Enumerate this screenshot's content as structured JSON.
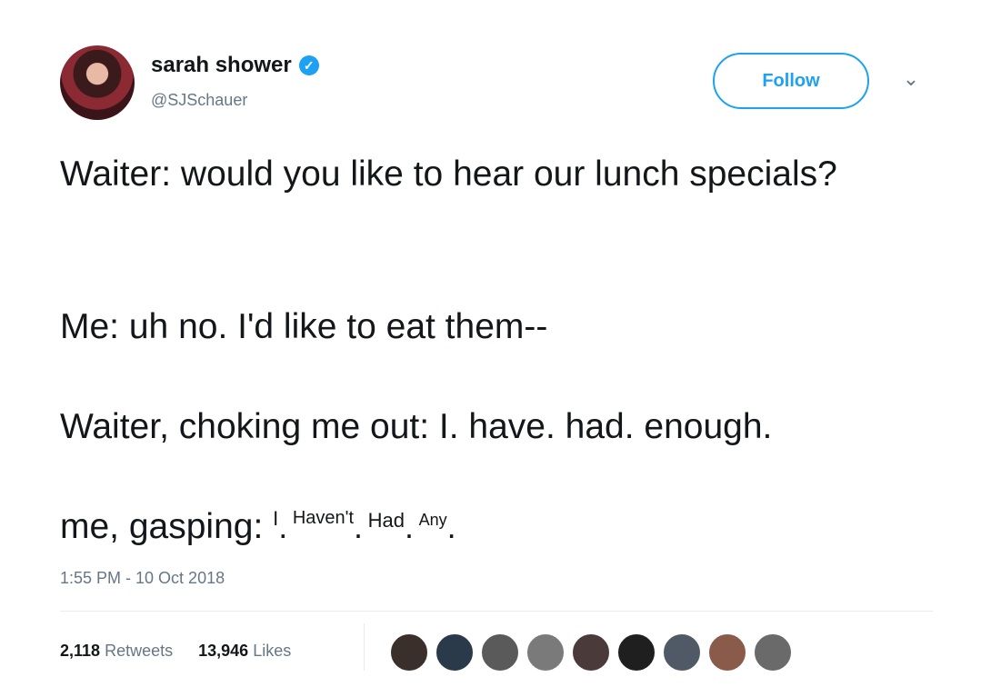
{
  "tweet": {
    "display_name": "sarah shower",
    "handle": "@SJSchauer",
    "follow_label": "Follow",
    "lines": [
      "Waiter: would you like to hear our lunch specials?",
      "Me: uh no. I'd like to eat them--",
      "Waiter, choking me out: I. have. had. enough.",
      "me, gasping:"
    ],
    "gasp_words": [
      "I",
      "Haven't",
      "Had",
      "Any"
    ],
    "timestamp": "1:55 PM - 10 Oct 2018",
    "retweets_count": "2,118",
    "retweets_label": "Retweets",
    "likes_count": "13,946",
    "likes_label": "Likes"
  },
  "icons": {
    "verified": "verified-badge-icon",
    "menu": "chevron-down-icon"
  },
  "colors": {
    "accent": "#1da1f2",
    "text": "#14171a",
    "secondary": "#657786"
  },
  "likers": [
    {
      "color": "#3a2f2a"
    },
    {
      "color": "#2b3a4a"
    },
    {
      "color": "#5a5a5a"
    },
    {
      "color": "#7a7a7a"
    },
    {
      "color": "#4a3a3a"
    },
    {
      "color": "#1f1f1f"
    },
    {
      "color": "#505a66"
    },
    {
      "color": "#8a5a4a"
    },
    {
      "color": "#6a6a6a"
    }
  ]
}
